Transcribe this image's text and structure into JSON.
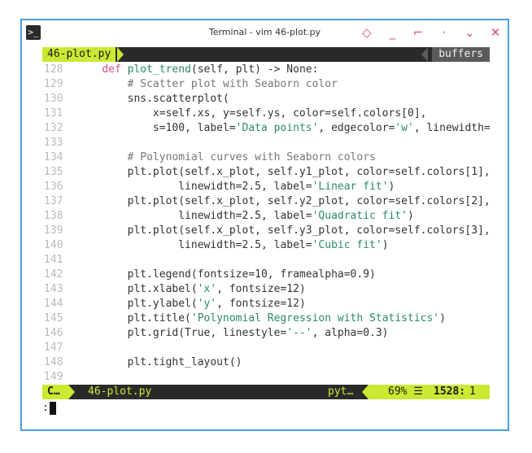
{
  "window": {
    "title": "Terminal - vim 46-plot.py",
    "terminal_icon": ">_"
  },
  "tabline": {
    "active_tab": "46-plot.py",
    "buffers_label": "buffers"
  },
  "code_lines": [
    {
      "n": "128",
      "segs": [
        [
          "",
          "    "
        ],
        [
          "kw",
          "def"
        ],
        [
          "",
          " "
        ],
        [
          "fn",
          "plot_trend"
        ],
        [
          "",
          "(self, plt) -> None:"
        ]
      ]
    },
    {
      "n": "129",
      "segs": [
        [
          "",
          "        "
        ],
        [
          "cm",
          "# Scatter plot with Seaborn color"
        ]
      ]
    },
    {
      "n": "130",
      "segs": [
        [
          "",
          "        sns.scatterplot("
        ]
      ]
    },
    {
      "n": "131",
      "segs": [
        [
          "",
          "            x=self.xs, y=self.ys, color=self.colors[0],"
        ]
      ]
    },
    {
      "n": "132",
      "segs": [
        [
          "",
          "            s=100, label="
        ],
        [
          "str",
          "'Data points'"
        ],
        [
          "",
          ", edgecolor="
        ],
        [
          "str",
          "'w'"
        ],
        [
          "",
          ", linewidth="
        ]
      ]
    },
    {
      "n": "133",
      "segs": [
        [
          "",
          ""
        ]
      ]
    },
    {
      "n": "134",
      "segs": [
        [
          "",
          "        "
        ],
        [
          "cm",
          "# Polynomial curves with Seaborn colors"
        ]
      ]
    },
    {
      "n": "135",
      "segs": [
        [
          "",
          "        plt.plot(self.x_plot, self.y1_plot, color=self.colors[1],"
        ]
      ]
    },
    {
      "n": "136",
      "segs": [
        [
          "",
          "                linewidth=2.5, label="
        ],
        [
          "str",
          "'Linear fit'"
        ],
        [
          "",
          ")"
        ]
      ]
    },
    {
      "n": "137",
      "segs": [
        [
          "",
          "        plt.plot(self.x_plot, self.y2_plot, color=self.colors[2],"
        ]
      ]
    },
    {
      "n": "138",
      "segs": [
        [
          "",
          "                linewidth=2.5, label="
        ],
        [
          "str",
          "'Quadratic fit'"
        ],
        [
          "",
          ")"
        ]
      ]
    },
    {
      "n": "139",
      "segs": [
        [
          "",
          "        plt.plot(self.x_plot, self.y3_plot, color=self.colors[3],"
        ]
      ]
    },
    {
      "n": "140",
      "segs": [
        [
          "",
          "                linewidth=2.5, label="
        ],
        [
          "str",
          "'Cubic fit'"
        ],
        [
          "",
          ")"
        ]
      ]
    },
    {
      "n": "141",
      "segs": [
        [
          "",
          ""
        ]
      ]
    },
    {
      "n": "142",
      "segs": [
        [
          "",
          "        plt.legend(fontsize=10, framealpha=0.9)"
        ]
      ]
    },
    {
      "n": "143",
      "segs": [
        [
          "",
          "        plt.xlabel("
        ],
        [
          "str",
          "'x'"
        ],
        [
          "",
          ", fontsize=12)"
        ]
      ]
    },
    {
      "n": "144",
      "segs": [
        [
          "",
          "        plt.ylabel("
        ],
        [
          "str",
          "'y'"
        ],
        [
          "",
          ", fontsize=12)"
        ]
      ]
    },
    {
      "n": "145",
      "segs": [
        [
          "",
          "        plt.title("
        ],
        [
          "str",
          "'Polynomial Regression with Statistics'"
        ],
        [
          "",
          ")"
        ]
      ]
    },
    {
      "n": "146",
      "segs": [
        [
          "",
          "        plt.grid(True, linestyle="
        ],
        [
          "str",
          "'--'"
        ],
        [
          "",
          ", alpha=0.3)"
        ]
      ]
    },
    {
      "n": "147",
      "segs": [
        [
          "",
          ""
        ]
      ]
    },
    {
      "n": "148",
      "segs": [
        [
          "",
          "        plt.tight_layout()"
        ]
      ]
    },
    {
      "n": "149",
      "segs": [
        [
          "",
          ""
        ]
      ]
    }
  ],
  "statusline": {
    "mode": "C…",
    "filename": "46-plot.py",
    "filetype": "pyt…",
    "percent": "69% ☰",
    "line": "1528:",
    "col": "1"
  },
  "cmdline": {
    "text": ":"
  },
  "colors": {
    "accent": "#cde832",
    "window_border": "#4a9ee0",
    "keyword": "#d64f8a",
    "string": "#2a8a6a"
  },
  "icons": [
    "terminal-icon",
    "pin-icon",
    "minimize-icon",
    "maximize-icon",
    "dot-icon",
    "chevron-down-icon",
    "close-icon"
  ]
}
